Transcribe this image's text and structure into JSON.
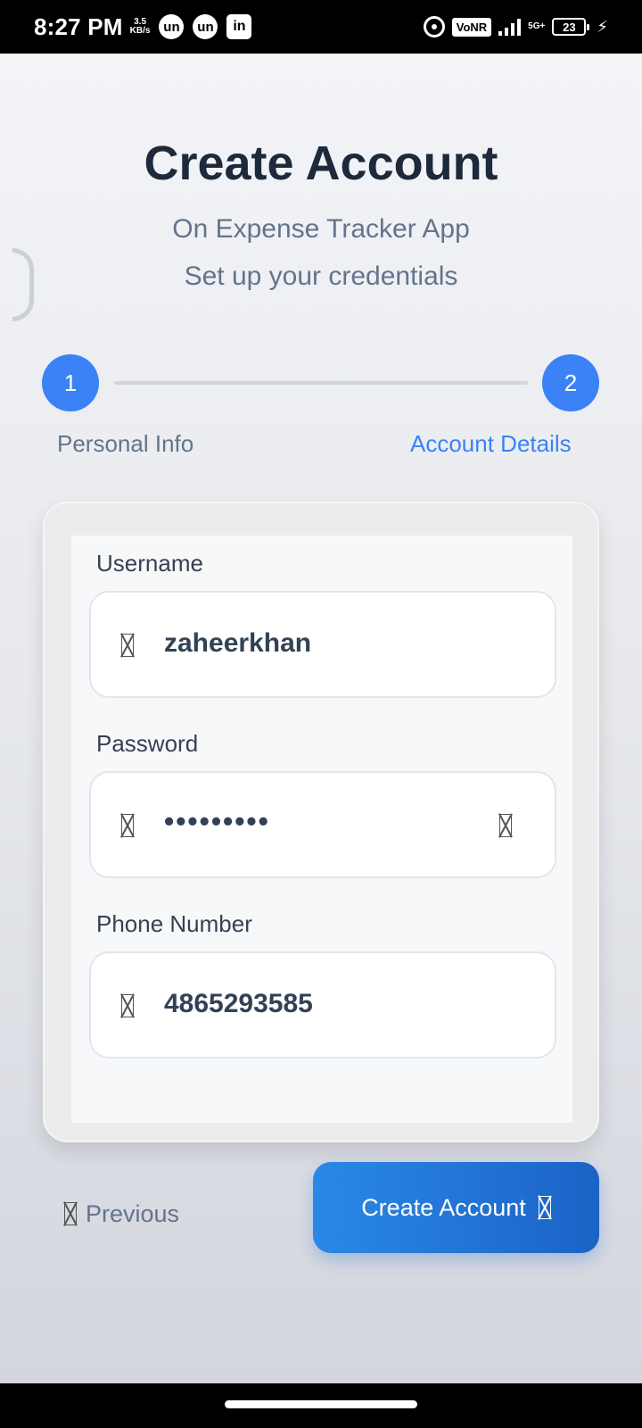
{
  "status_bar": {
    "time": "8:27 PM",
    "speed_value": "3.5",
    "speed_unit": "KB/s",
    "app_icons": [
      "un",
      "un",
      "in"
    ],
    "vonr": "VoNR",
    "network": "5G+",
    "battery": "23"
  },
  "header": {
    "title": "Create Account",
    "subtitle_1": "On Expense Tracker App",
    "subtitle_2": "Set up your credentials"
  },
  "stepper": {
    "steps": [
      {
        "number": "1",
        "label": "Personal Info"
      },
      {
        "number": "2",
        "label": "Account Details"
      }
    ],
    "active_step": 2,
    "accent_color": "#3b82f6"
  },
  "form": {
    "username": {
      "label": "Username",
      "value": "zaheerkhan",
      "icon": "user-icon"
    },
    "password": {
      "label": "Password",
      "value": "•••••••••",
      "icon": "lock-icon",
      "toggle_icon": "eye-icon"
    },
    "phone": {
      "label": "Phone Number",
      "value": "4865293585",
      "icon": "phone-icon"
    }
  },
  "actions": {
    "previous_label": "Previous",
    "previous_icon": "arrow-left-icon",
    "create_label": "Create Account",
    "create_icon": "arrow-right-icon",
    "button_color": "#1f74d6"
  }
}
